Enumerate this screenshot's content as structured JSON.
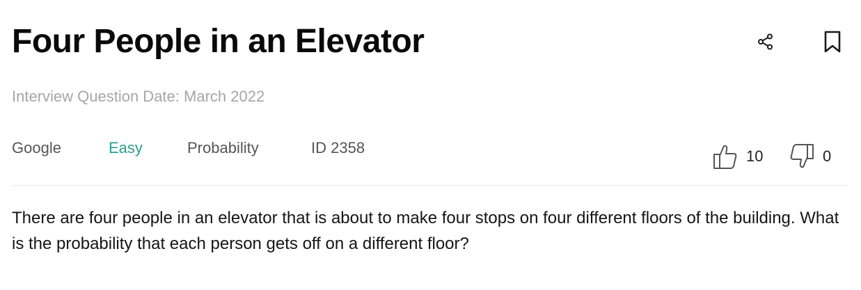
{
  "question": {
    "title": "Four People in an Elevator",
    "date_line": "Interview Question Date: March 2022",
    "tags": {
      "company": "Google",
      "difficulty": "Easy",
      "category": "Probability",
      "id": "ID 2358"
    },
    "votes": {
      "up": "10",
      "down": "0"
    },
    "body": "There are four people in an elevator that is about to make four stops on four different floors of the building. What is the probability that each person gets off on a different floor?"
  },
  "actions": {
    "share_icon": "share-icon",
    "bookmark_icon": "bookmark-icon"
  },
  "colors": {
    "difficulty_easy": "#2a9d92",
    "muted_text": "#a6a6a6"
  }
}
